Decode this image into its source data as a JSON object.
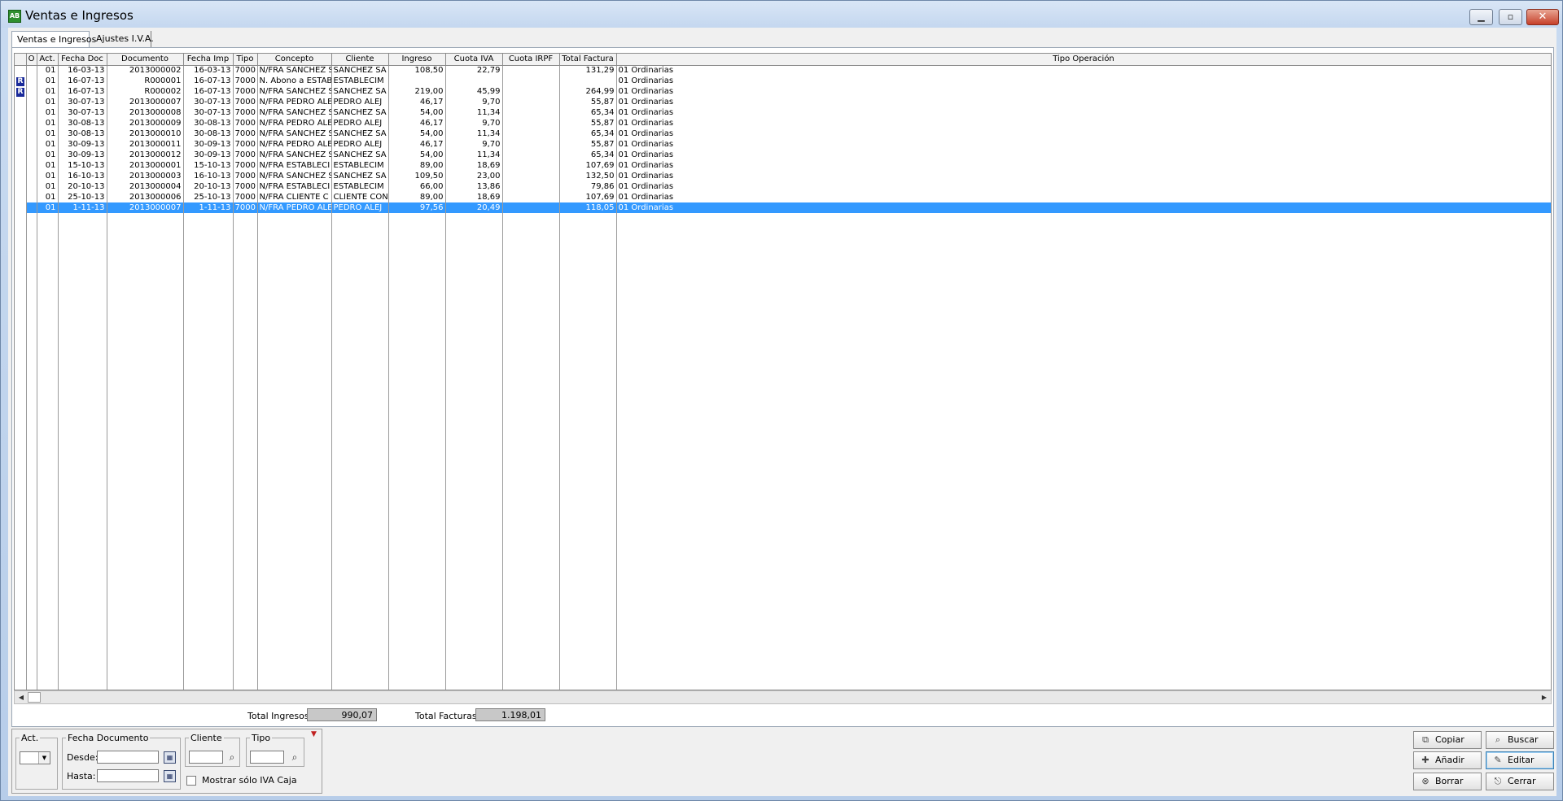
{
  "window": {
    "title": "Ventas e Ingresos",
    "app_icon_text": "AB",
    "minimize_glyph": "▁",
    "maximize_glyph": "▫",
    "close_glyph": "✕"
  },
  "tabs": [
    {
      "label": "Ventas e Ingresos",
      "active": true
    },
    {
      "label": "Ajustes I.V.A.",
      "active": false
    }
  ],
  "grid": {
    "columns": [
      "",
      "O",
      "Act.",
      "Fecha Doc",
      "Documento",
      "Fecha Imp",
      "Tipo",
      "Concepto",
      "Cliente",
      "Ingreso",
      "Cuota IVA",
      "Cuota IRPF",
      "Total Factura",
      "Tipo Operación"
    ],
    "rows": [
      {
        "mark": "",
        "act": "01",
        "fecha_doc": "16-03-13",
        "documento": "2013000002",
        "fecha_imp": "16-03-13",
        "tipo": "7000",
        "concepto": "N/FRA SANCHEZ S",
        "cliente": "SANCHEZ SA",
        "ingreso": "108,50",
        "cuota_iva": "22,79",
        "cuota_irpf": "",
        "total": "131,29",
        "tipo_op": "01   Ordinarias"
      },
      {
        "mark": "R",
        "act": "01",
        "fecha_doc": "16-07-13",
        "documento": "R000001",
        "fecha_imp": "16-07-13",
        "tipo": "7000",
        "concepto": "N. Abono a ESTAB",
        "cliente": "ESTABLECIM",
        "ingreso": "",
        "cuota_iva": "",
        "cuota_irpf": "",
        "total": "",
        "tipo_op": "01   Ordinarias"
      },
      {
        "mark": "R",
        "act": "01",
        "fecha_doc": "16-07-13",
        "documento": "R000002",
        "fecha_imp": "16-07-13",
        "tipo": "7000",
        "concepto": "N/FRA SANCHEZ S",
        "cliente": "SANCHEZ SA",
        "ingreso": "219,00",
        "cuota_iva": "45,99",
        "cuota_irpf": "",
        "total": "264,99",
        "tipo_op": "01   Ordinarias"
      },
      {
        "mark": "",
        "act": "01",
        "fecha_doc": "30-07-13",
        "documento": "2013000007",
        "fecha_imp": "30-07-13",
        "tipo": "7000",
        "concepto": "N/FRA PEDRO ALE",
        "cliente": "PEDRO ALEJ",
        "ingreso": "46,17",
        "cuota_iva": "9,70",
        "cuota_irpf": "",
        "total": "55,87",
        "tipo_op": "01   Ordinarias"
      },
      {
        "mark": "",
        "act": "01",
        "fecha_doc": "30-07-13",
        "documento": "2013000008",
        "fecha_imp": "30-07-13",
        "tipo": "7000",
        "concepto": "N/FRA SANCHEZ S",
        "cliente": "SANCHEZ SA",
        "ingreso": "54,00",
        "cuota_iva": "11,34",
        "cuota_irpf": "",
        "total": "65,34",
        "tipo_op": "01   Ordinarias"
      },
      {
        "mark": "",
        "act": "01",
        "fecha_doc": "30-08-13",
        "documento": "2013000009",
        "fecha_imp": "30-08-13",
        "tipo": "7000",
        "concepto": "N/FRA PEDRO ALE",
        "cliente": "PEDRO ALEJ",
        "ingreso": "46,17",
        "cuota_iva": "9,70",
        "cuota_irpf": "",
        "total": "55,87",
        "tipo_op": "01   Ordinarias"
      },
      {
        "mark": "",
        "act": "01",
        "fecha_doc": "30-08-13",
        "documento": "2013000010",
        "fecha_imp": "30-08-13",
        "tipo": "7000",
        "concepto": "N/FRA SANCHEZ S",
        "cliente": "SANCHEZ SA",
        "ingreso": "54,00",
        "cuota_iva": "11,34",
        "cuota_irpf": "",
        "total": "65,34",
        "tipo_op": "01   Ordinarias"
      },
      {
        "mark": "",
        "act": "01",
        "fecha_doc": "30-09-13",
        "documento": "2013000011",
        "fecha_imp": "30-09-13",
        "tipo": "7000",
        "concepto": "N/FRA PEDRO ALE",
        "cliente": "PEDRO ALEJ",
        "ingreso": "46,17",
        "cuota_iva": "9,70",
        "cuota_irpf": "",
        "total": "55,87",
        "tipo_op": "01   Ordinarias"
      },
      {
        "mark": "",
        "act": "01",
        "fecha_doc": "30-09-13",
        "documento": "2013000012",
        "fecha_imp": "30-09-13",
        "tipo": "7000",
        "concepto": "N/FRA SANCHEZ S",
        "cliente": "SANCHEZ SA",
        "ingreso": "54,00",
        "cuota_iva": "11,34",
        "cuota_irpf": "",
        "total": "65,34",
        "tipo_op": "01   Ordinarias"
      },
      {
        "mark": "",
        "act": "01",
        "fecha_doc": "15-10-13",
        "documento": "2013000001",
        "fecha_imp": "15-10-13",
        "tipo": "7000",
        "concepto": "N/FRA ESTABLECI",
        "cliente": "ESTABLECIM",
        "ingreso": "89,00",
        "cuota_iva": "18,69",
        "cuota_irpf": "",
        "total": "107,69",
        "tipo_op": "01   Ordinarias"
      },
      {
        "mark": "",
        "act": "01",
        "fecha_doc": "16-10-13",
        "documento": "2013000003",
        "fecha_imp": "16-10-13",
        "tipo": "7000",
        "concepto": "N/FRA SANCHEZ S",
        "cliente": "SANCHEZ SA",
        "ingreso": "109,50",
        "cuota_iva": "23,00",
        "cuota_irpf": "",
        "total": "132,50",
        "tipo_op": "01   Ordinarias"
      },
      {
        "mark": "",
        "act": "01",
        "fecha_doc": "20-10-13",
        "documento": "2013000004",
        "fecha_imp": "20-10-13",
        "tipo": "7000",
        "concepto": "N/FRA ESTABLECI",
        "cliente": "ESTABLECIM",
        "ingreso": "66,00",
        "cuota_iva": "13,86",
        "cuota_irpf": "",
        "total": "79,86",
        "tipo_op": "01   Ordinarias"
      },
      {
        "mark": "",
        "act": "01",
        "fecha_doc": "25-10-13",
        "documento": "2013000006",
        "fecha_imp": "25-10-13",
        "tipo": "7000",
        "concepto": "N/FRA CLIENTE C",
        "cliente": "CLIENTE CON",
        "ingreso": "89,00",
        "cuota_iva": "18,69",
        "cuota_irpf": "",
        "total": "107,69",
        "tipo_op": "01   Ordinarias"
      },
      {
        "mark": "",
        "act": "01",
        "fecha_doc": "1-11-13",
        "documento": "2013000007",
        "fecha_imp": "1-11-13",
        "tipo": "7000",
        "concepto": "N/FRA PEDRO ALE",
        "cliente": "PEDRO ALEJ",
        "ingreso": "97,56",
        "cuota_iva": "20,49",
        "cuota_irpf": "",
        "total": "118,05",
        "tipo_op": "01   Ordinarias",
        "selected": true
      }
    ]
  },
  "totals": {
    "ingresos_label": "Total Ingresos:",
    "ingresos_value": "990,07",
    "facturas_label": "Total Facturas:",
    "facturas_value": "1.198,01"
  },
  "filters": {
    "act_legend": "Act.",
    "act_value": "",
    "fecha_legend": "Fecha Documento",
    "desde_label": "Desde:",
    "desde_value": "",
    "hasta_label": "Hasta:",
    "hasta_value": "",
    "cliente_legend": "Cliente",
    "cliente_value": "",
    "tipo_legend": "Tipo",
    "tipo_value": "",
    "iva_caja_label": "Mostrar sólo IVA Caja",
    "iva_caja_checked": false
  },
  "buttons": {
    "copiar": "Copiar",
    "anadir": "Añadir",
    "borrar": "Borrar",
    "buscar": "Buscar",
    "editar": "Editar",
    "cerrar": "Cerrar"
  }
}
